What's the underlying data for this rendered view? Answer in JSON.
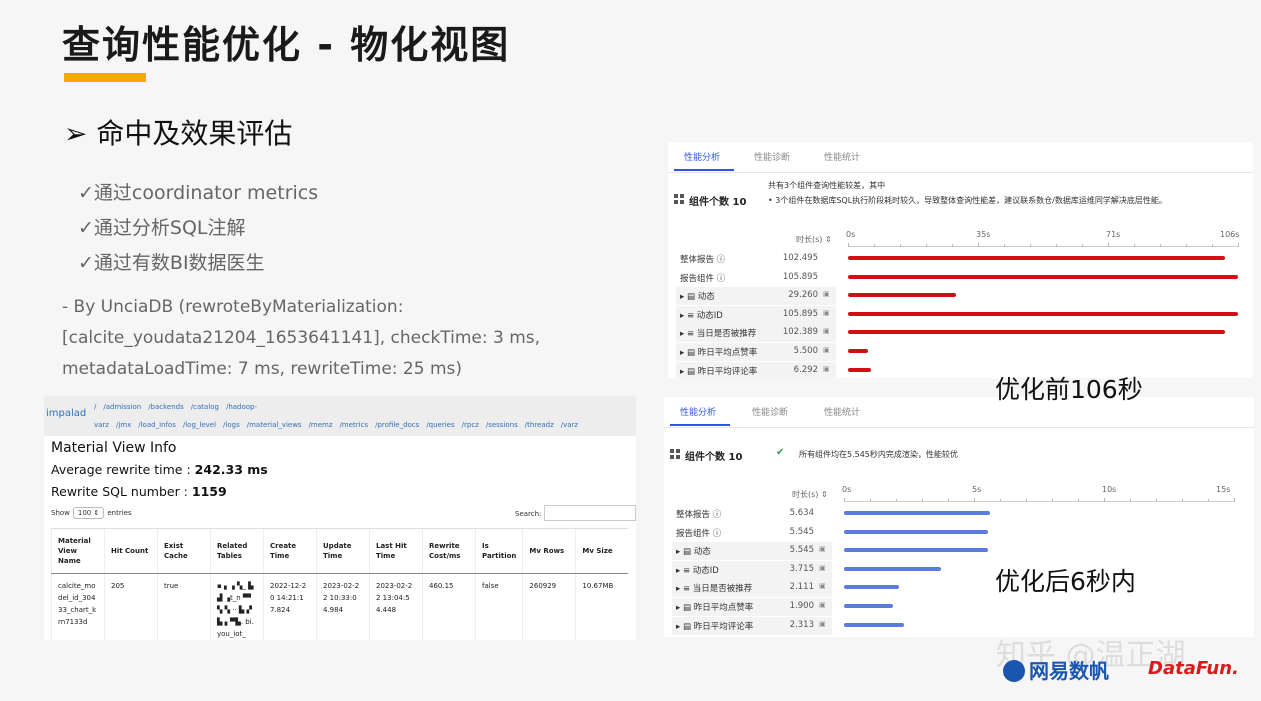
{
  "slide": {
    "title": "查询性能优化 - 物化视图",
    "subtitle": "➢ 命中及效果评估",
    "bullets": [
      "✓通过coordinator metrics",
      "✓通过分析SQL注解",
      "✓通过有数BI数据医生"
    ],
    "log_lines": [
      "- By UnciaDB (rewroteByMaterialization:",
      "[calcite_youdata21204_1653641141], checkTime: 3 ms,",
      "metadataLoadTime: 7 ms, rewriteTime: 25 ms)"
    ],
    "before_label": "优化前106秒",
    "after_label": "优化后6秒内",
    "watermark": "知乎 @温正湖",
    "logo_text": "网易数帆",
    "logo2_text": "DataFun."
  },
  "impalad": {
    "brand": "impalad",
    "nav_links": [
      "/",
      "/admission",
      "/backends",
      "/catalog",
      "/hadoop-varz",
      "/jmx",
      "/load_infos",
      "/log_level",
      "/logs",
      "/material_views",
      "/memz",
      "/metrics",
      "/profile_docs",
      "/queries",
      "/rpcz",
      "/sessions",
      "/threadz",
      "/varz"
    ],
    "page_title": "Material View Info",
    "avg_label": "Average rewrite time : ",
    "avg_value": "242.33 ms",
    "sql_label": "Rewrite SQL number : ",
    "sql_value": "1159",
    "show_label": "Show",
    "show_value": "100 ⇕",
    "entries_label": "entries",
    "search_label": "Search:",
    "columns": [
      "Material View Name",
      "Hit Count",
      "Exist Cache",
      "Related Tables",
      "Create Time",
      "Update Time",
      "Last Hit Time",
      "Rewrite Cost/ms",
      "Is Partition",
      "Mv Rows",
      "Mv Size"
    ],
    "row": [
      "calcite_model_id_30433_chart_krn7133d",
      "205",
      "true",
      "▪ ▖▗ ▚_ ▙▟ ▗t_n ▀▘▚ ▚ ·· ▙ ▞ ▙ ▖▀▙. bi.you_iot_",
      "2022-12-20 14:21:17.824",
      "2023-02-22 10:33:04.984",
      "2023-02-22 13:04:54.448",
      "460.15",
      "false",
      "260929",
      "10.67MB"
    ]
  },
  "perf_before": {
    "tabs": [
      "性能分析",
      "性能诊断",
      "性能统计"
    ],
    "count_label": "组件个数 10",
    "summary_line1": "共有3个组件查询性能较差，其中",
    "summary_line2": "•  3个组件在数据库SQL执行阶段耗时较久，导致整体查询性能差，建议联系数仓/数据库运维同学解决底层性能。",
    "duration_header": "时长(s) ⇕",
    "axis_ticks": [
      "0s",
      "35s",
      "71s",
      "106s"
    ],
    "axis_max": 106,
    "rows": [
      {
        "label": "整体报告 ⓘ",
        "value": "102.495",
        "num": 102.495
      },
      {
        "label": "报告组件 ⓘ",
        "value": "105.895",
        "num": 105.895
      },
      {
        "label": "▸  ▤  动态",
        "value": "29.260",
        "num": 29.26
      },
      {
        "label": "▸  ≡  动态ID",
        "value": "105.895",
        "num": 105.895
      },
      {
        "label": "▸  ≡  当日是否被推荐",
        "value": "102.389",
        "num": 102.389
      },
      {
        "label": "▸  ▤  昨日平均点赞率",
        "value": "5.500",
        "num": 5.5
      },
      {
        "label": "▸  ▤  昨日平均评论率",
        "value": "6.292",
        "num": 6.292
      }
    ],
    "color": "#d40f14"
  },
  "perf_after": {
    "tabs": [
      "性能分析",
      "性能诊断",
      "性能统计"
    ],
    "count_label": "组件个数 10",
    "summary": "所有组件均在5.545秒内完成渲染，性能较优",
    "duration_header": "时长(s) ⇕",
    "axis_ticks": [
      "0s",
      "5s",
      "10s",
      "15s"
    ],
    "axis_max": 15,
    "rows": [
      {
        "label": "整体报告 ⓘ",
        "value": "5.634",
        "num": 5.634
      },
      {
        "label": "报告组件 ⓘ",
        "value": "5.545",
        "num": 5.545
      },
      {
        "label": "▸  ▤  动态",
        "value": "5.545",
        "num": 5.545
      },
      {
        "label": "▸  ≡  动态ID",
        "value": "3.715",
        "num": 3.715
      },
      {
        "label": "▸  ≡  当日是否被推荐",
        "value": "2.111",
        "num": 2.111
      },
      {
        "label": "▸  ▤  昨日平均点赞率",
        "value": "1.900",
        "num": 1.9
      },
      {
        "label": "▸  ▤  昨日平均评论率",
        "value": "2.313",
        "num": 2.313
      }
    ],
    "color": "#5a7be0"
  }
}
